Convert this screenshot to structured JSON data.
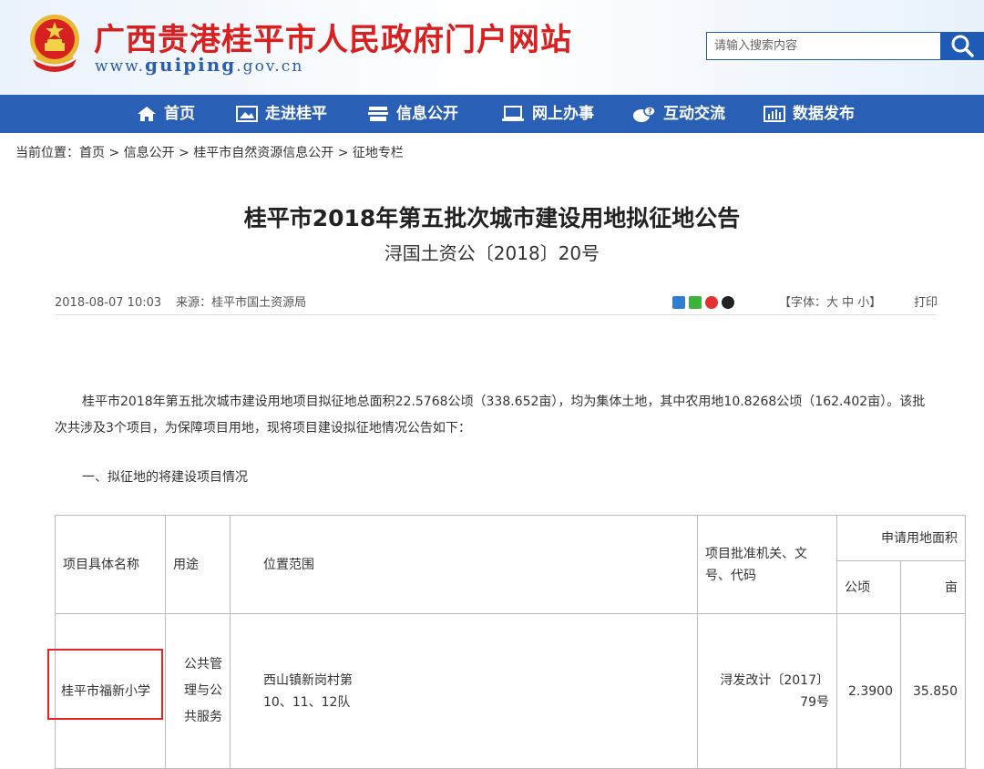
{
  "header": {
    "site_title": "广西贵港桂平市人民政府门户网站",
    "url_prefix": "www.",
    "url_main": "guiping",
    "url_suffix": ".gov.cn",
    "search_placeholder": "请输入搜索内容"
  },
  "nav": {
    "items": [
      {
        "label": "首页",
        "icon": "home-icon"
      },
      {
        "label": "走进桂平",
        "icon": "picture-icon"
      },
      {
        "label": "信息公开",
        "icon": "document-icon"
      },
      {
        "label": "网上办事",
        "icon": "laptop-icon"
      },
      {
        "label": "互动交流",
        "icon": "chat-icon"
      },
      {
        "label": "数据发布",
        "icon": "bar-chart-icon"
      }
    ]
  },
  "breadcrumb": "当前位置：首页 > 信息公开 > 桂平市自然资源信息公开 > 征地专栏",
  "article": {
    "title": "桂平市2018年第五批次城市建设用地拟征地公告",
    "subtitle": "浔国土资公〔2018〕20号",
    "date": "2018-08-07 10:03",
    "source": "来源：桂平市国土资源局",
    "font_size": "【字体：大 中 小】",
    "print": "打印",
    "paragraph": "桂平市2018年第五批次城市建设用地项目拟征地总面积22.5768公顷（338.652亩），均为集体土地，其中农用地10.8268公顷（162.402亩）。该批次共涉及3个项目，为保障项目用地，现将项目建设拟征地情况公告如下：",
    "section_heading": "一、拟征地的将建设项目情况"
  },
  "table": {
    "headers": {
      "name": "项目具体名称",
      "use": "用途",
      "location": "位置范围",
      "approval": "项目批准机关、文号、代码",
      "area_group": "申请用地面积",
      "hectare": "公顷",
      "mu": "亩"
    },
    "rows": [
      {
        "name": "桂平市福新小学",
        "use": "公共管理与公共服务",
        "location": "西山镇新岗村第10、11、12队",
        "approval": "浔发改计〔2017〕79号",
        "hectare": "2.3900",
        "mu": "35.850"
      }
    ]
  },
  "colors": {
    "nav_bg": "#2a5fb6",
    "title_red": "#d7201f",
    "highlight_red": "#e0262a"
  }
}
